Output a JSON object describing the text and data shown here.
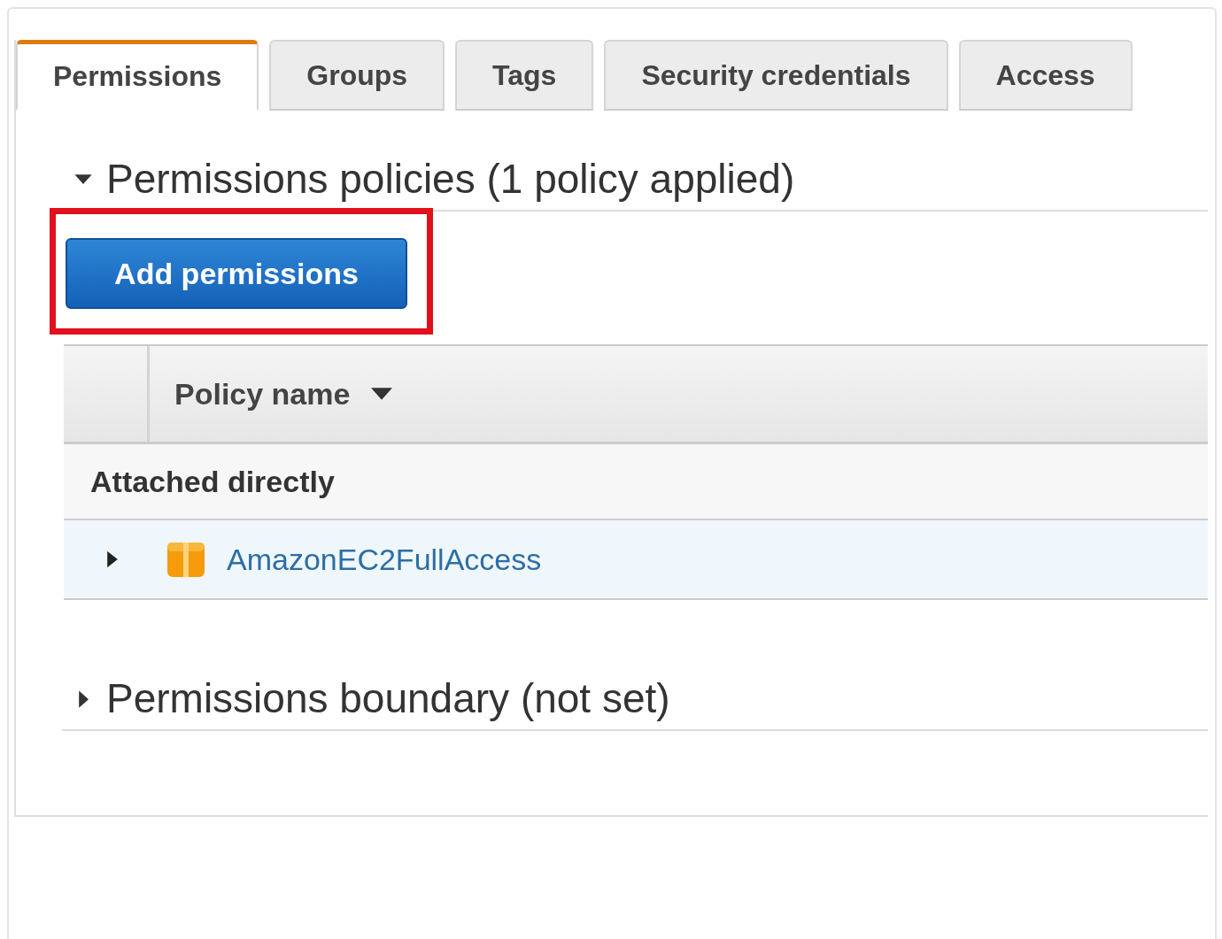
{
  "tabs": [
    {
      "label": "Permissions",
      "selected": true
    },
    {
      "label": "Groups",
      "selected": false
    },
    {
      "label": "Tags",
      "selected": false
    },
    {
      "label": "Security credentials",
      "selected": false
    },
    {
      "label": "Access",
      "selected": false
    }
  ],
  "policies_section": {
    "title": "Permissions policies (1 policy applied)",
    "expanded": true,
    "add_button": {
      "label": "Add permissions",
      "highlighted": true
    },
    "table": {
      "columns": [
        "Policy name"
      ],
      "groups": [
        {
          "label": "Attached directly",
          "rows": [
            {
              "name": "AmazonEC2FullAccess",
              "expanded": false
            }
          ]
        }
      ]
    }
  },
  "boundary_section": {
    "title": "Permissions boundary (not set)",
    "expanded": false
  }
}
